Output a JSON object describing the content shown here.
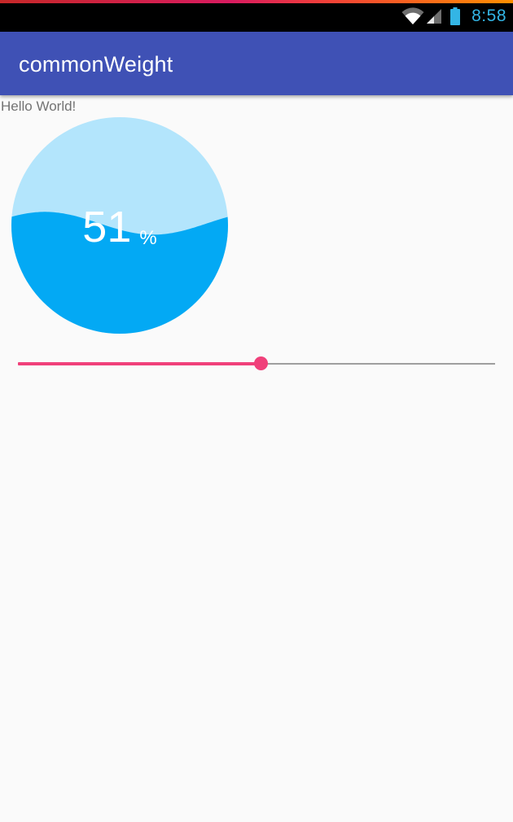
{
  "status_bar": {
    "time": "8:58",
    "icons": [
      "wifi-icon",
      "signal-icon",
      "battery-icon"
    ],
    "clock_color": "#33B5E5"
  },
  "app_bar": {
    "title": "commonWeight",
    "color": "#3F51B5"
  },
  "content": {
    "hello_text": "Hello World!"
  },
  "wave_view": {
    "value": "51",
    "unit": "%",
    "level": 0.51,
    "colors": {
      "back_wave": "#B3E5FC",
      "front_wave": "#03A9F4"
    }
  },
  "seekbar": {
    "progress": 0.51,
    "accent_color": "#F0407A"
  }
}
